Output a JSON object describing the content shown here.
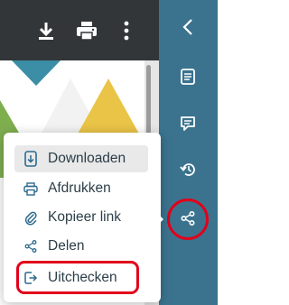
{
  "colors": {
    "toolbar": "#333639",
    "rail": "#3b738f",
    "highlight": "#e2001a",
    "menu_text": "#2c3e48",
    "icon_blue": "#2d6a8f"
  },
  "toolbar": {
    "icons": [
      "download-icon",
      "print-icon",
      "more-vertical-icon"
    ]
  },
  "rail": {
    "icons": [
      "chevron-left-icon",
      "document-icon",
      "comment-icon",
      "history-icon",
      "share-icon"
    ]
  },
  "menu": {
    "items": [
      {
        "label": "Downloaden",
        "icon": "download-file-icon",
        "active": true
      },
      {
        "label": "Afdrukken",
        "icon": "print-icon",
        "active": false
      },
      {
        "label": "Kopieer link",
        "icon": "paperclip-icon",
        "active": false
      },
      {
        "label": "Delen",
        "icon": "share-icon",
        "active": false
      },
      {
        "label": "Uitchecken",
        "icon": "checkout-icon",
        "active": false
      }
    ]
  }
}
